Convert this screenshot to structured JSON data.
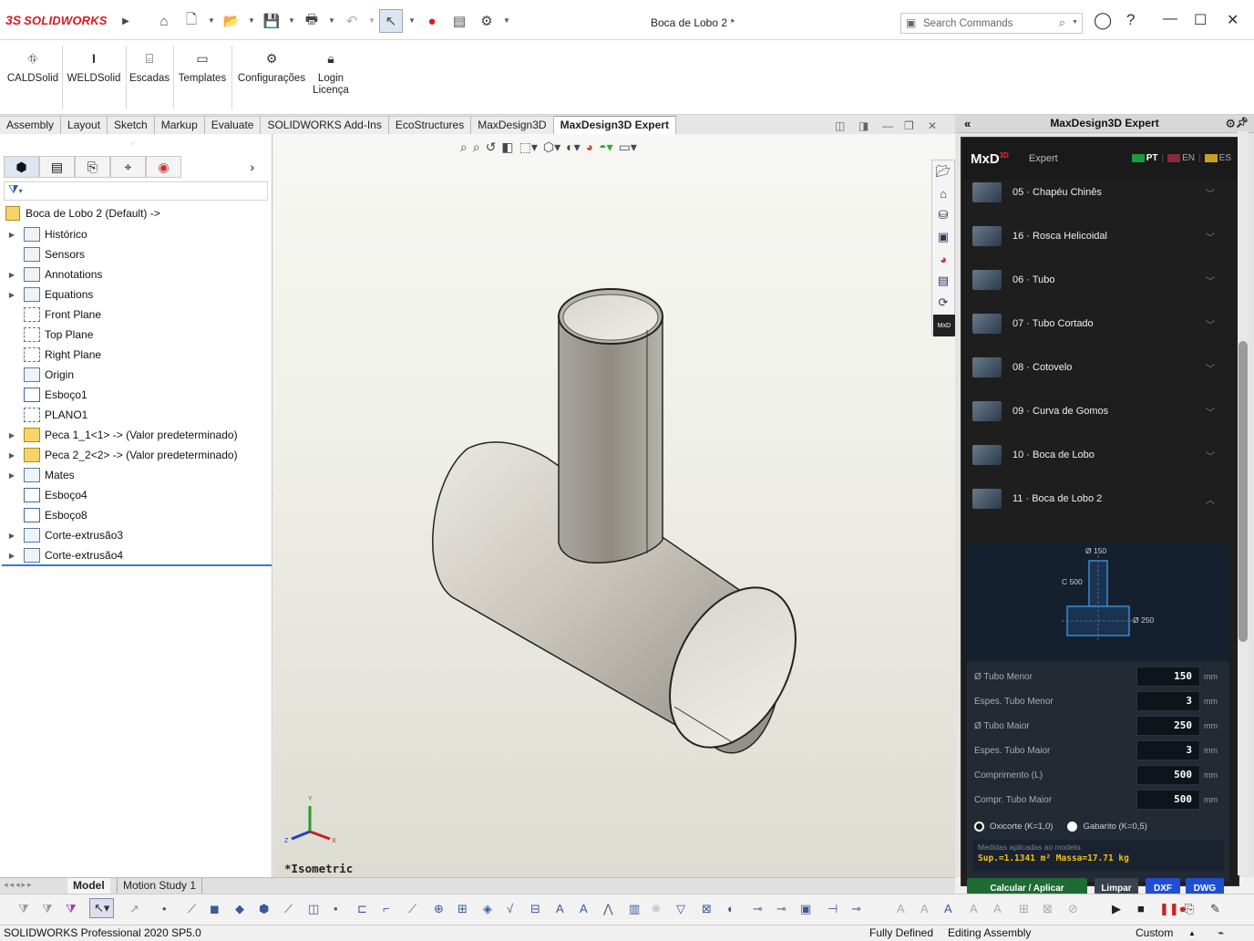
{
  "app": {
    "brand_ds": "3S",
    "brand": "SOLIDWORKS",
    "doc_title": "Boca de Lobo 2 *"
  },
  "search": {
    "placeholder": "Search Commands"
  },
  "command_manager": [
    {
      "label": "CALDSolid",
      "icon": "caldsolid-icon"
    },
    {
      "label": "WELDSolid",
      "icon": "weldsolid-icon"
    },
    {
      "label": "Escadas",
      "icon": "stairs-icon"
    },
    {
      "label": "Templates",
      "icon": "templates-icon"
    },
    {
      "label": "Configurações",
      "icon": "gear-icon"
    },
    {
      "label": "Login\nLicença",
      "label1": "Login",
      "label2": "Licença",
      "icon": "lock-icon"
    }
  ],
  "tabs": [
    "Assembly",
    "Layout",
    "Sketch",
    "Markup",
    "Evaluate",
    "SOLIDWORKS Add-Ins",
    "EcoStructures",
    "MaxDesign3D",
    "MaxDesign3D Expert"
  ],
  "active_tab": "MaxDesign3D Expert",
  "tree": {
    "root": "Boca de Lobo 2  (Default) ->",
    "items": [
      {
        "label": "Histórico",
        "expandable": true,
        "icon": "history-icon"
      },
      {
        "label": "Sensors",
        "expandable": false,
        "icon": "sensor-icon"
      },
      {
        "label": "Annotations",
        "expandable": true,
        "icon": "annotations-icon"
      },
      {
        "label": "Equations",
        "expandable": true,
        "icon": "equations-icon"
      },
      {
        "label": "Front Plane",
        "expandable": false,
        "icon": "plane-icon"
      },
      {
        "label": "Top Plane",
        "expandable": false,
        "icon": "plane-icon"
      },
      {
        "label": "Right Plane",
        "expandable": false,
        "icon": "plane-icon"
      },
      {
        "label": "Origin",
        "expandable": false,
        "icon": "origin-icon"
      },
      {
        "label": "Esboço1",
        "expandable": false,
        "icon": "sketch-icon"
      },
      {
        "label": "PLANO1",
        "expandable": false,
        "icon": "plane-icon"
      },
      {
        "label": "Peca 1_1<1> -> (Valor predeterminado)",
        "expandable": true,
        "icon": "part-icon"
      },
      {
        "label": "Peca 2_2<2> -> (Valor predeterminado)",
        "expandable": true,
        "icon": "part-icon"
      },
      {
        "label": "Mates",
        "expandable": true,
        "icon": "mates-icon"
      },
      {
        "label": "Esboço4",
        "expandable": false,
        "icon": "sketch-icon"
      },
      {
        "label": "Esboço8",
        "expandable": false,
        "icon": "sketch-icon"
      },
      {
        "label": "Corte-extrusão3",
        "expandable": true,
        "icon": "cut-extrude-icon"
      },
      {
        "label": "Corte-extrusão4",
        "expandable": true,
        "icon": "cut-extrude-icon"
      }
    ]
  },
  "viewport": {
    "view_label": "*Isometric"
  },
  "panel": {
    "title": "MaxDesign3D Expert",
    "logo": "MxD",
    "logo_sup": "3D",
    "mode": "Expert",
    "langs": [
      "PT",
      "EN",
      "ES"
    ],
    "items": [
      {
        "label": "05 · Chapéu Chinês"
      },
      {
        "label": "16 · Rosca Helicoidal"
      },
      {
        "label": "06 · Tubo"
      },
      {
        "label": "07 · Tubo Cortado"
      },
      {
        "label": "08 · Cotovelo"
      },
      {
        "label": "09 · Curva de Gomos"
      },
      {
        "label": "10 · Boca de Lobo"
      },
      {
        "label": "11 · Boca de Lobo 2"
      }
    ],
    "diagram": {
      "d_small": "Ø 150",
      "c": "C 500",
      "d_large": "Ø 250"
    },
    "fields": [
      {
        "label": "Ø Tubo Menor",
        "value": "150",
        "unit": "mm"
      },
      {
        "label": "Espes. Tubo Menor",
        "value": "3",
        "unit": "mm"
      },
      {
        "label": "Ø Tubo Maior",
        "value": "250",
        "unit": "mm"
      },
      {
        "label": "Espes. Tubo Maior",
        "value": "3",
        "unit": "mm"
      },
      {
        "label": "Comprimento (L)",
        "value": "500",
        "unit": "mm"
      },
      {
        "label": "Compr. Tubo Maior",
        "value": "500",
        "unit": "mm"
      }
    ],
    "radio1": "Oxicorte (K=1,0)",
    "radio2": "Gabarito (K=0,5)",
    "note": "Medidas aplicadas ao modelo.",
    "results": "Sup.=1.1341 m²   Massa=17.71 kg",
    "buttons": {
      "apply": "Calcular / Aplicar",
      "clear": "Limpar",
      "dxf": "DXF",
      "dwg": "DWG"
    }
  },
  "bottom_tabs": [
    "Model",
    "Motion Study 1"
  ],
  "status": {
    "version": "SOLIDWORKS Professional 2020 SP5.0",
    "defined": "Fully Defined",
    "editing": "Editing Assembly",
    "units": "Custom"
  },
  "colors": {
    "accent_blue": "#3a7ac8",
    "brand_red": "#d71920",
    "apply_green": "#1f6b34",
    "dxf_blue": "#1f4fd0"
  }
}
